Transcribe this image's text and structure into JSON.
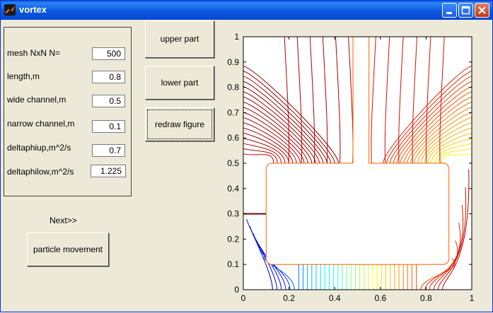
{
  "window": {
    "title": "vortex"
  },
  "params": [
    {
      "label": "mesh NxN N=",
      "value": "500"
    },
    {
      "label": "length,m",
      "value": "0.8"
    },
    {
      "label": "wide channel,m",
      "value": "0.5"
    },
    {
      "label": "narrow channel,m",
      "value": "0.1"
    },
    {
      "label": "deltaphiup,m^2/s",
      "value": "0.7"
    },
    {
      "label": "deltaphilow,m^2/s",
      "value": "1.225"
    }
  ],
  "buttons": {
    "upper": "upper part",
    "lower": "lower part",
    "redraw": "redraw figure",
    "particle": "particle movement"
  },
  "next_label": "Next>>",
  "chart_data": {
    "type": "contour",
    "xlim": [
      0,
      1
    ],
    "ylim": [
      0,
      1
    ],
    "x_ticks": [
      "0",
      "0.2",
      "0.4",
      "0.6",
      "0.8",
      "1"
    ],
    "y_ticks": [
      "0",
      "0.1",
      "0.2",
      "0.3",
      "0.4",
      "0.5",
      "0.6",
      "0.7",
      "0.8",
      "0.9",
      "1"
    ],
    "obstacle": {
      "x0": 0.1,
      "x1": 0.9,
      "y0": 0.1,
      "y1": 0.5
    },
    "slot": {
      "x0": 0.48,
      "x1": 0.55,
      "y0": 0.5,
      "y1": 1.0
    },
    "colormap": [
      "#00008f",
      "#0000ff",
      "#00a0ff",
      "#00ffff",
      "#80ff80",
      "#ffff00",
      "#ffa000",
      "#ff4000",
      "#c00000",
      "#800000"
    ],
    "inlet_y": 0.3,
    "lower_lines": 40,
    "upper_lines": 18,
    "grid": false
  }
}
